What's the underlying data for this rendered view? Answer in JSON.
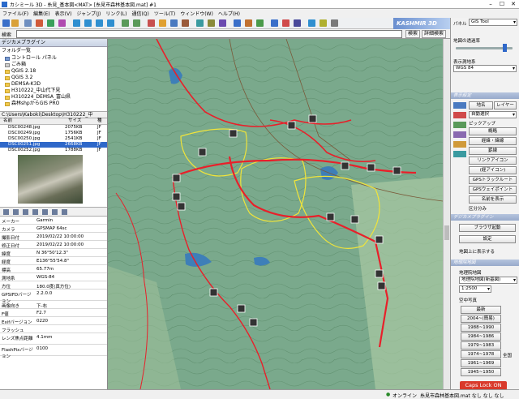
{
  "window": {
    "title": "カシミール 3D - 糸見_基本図<MAT> [糸見市森林基本図.mat] #1",
    "minimize": "–",
    "maximize": "☐",
    "close": "✕"
  },
  "menu": [
    "ファイル(F)",
    "編集(E)",
    "表示(V)",
    "ジャンプ(J)",
    "リンク(L)",
    "通信(Q)",
    "ツール(T)",
    "ウィンドウ(W)",
    "ヘルプ(H)"
  ],
  "branding": "KASHMIR 3D",
  "search": {
    "label": "検索",
    "value": "",
    "button_search": "検索",
    "button_detail": "詳細検索"
  },
  "left": {
    "plugin_header": "デジカメプラグイン",
    "folder_header": "フォルダ一覧",
    "folders": [
      "コントロール パネル",
      "ごみ箱",
      "QGIS 2.18",
      "QGIS 3.2",
      "DEMSA-K3D",
      "H310222_中山代下見",
      "H310224_DEMSA_富山県",
      "森林shpからGIS PRO"
    ],
    "path": "C:\\Users\\Kaboki\\Desktop\\H310222_中",
    "file_columns": [
      "名前",
      "サイズ",
      "種"
    ],
    "files": [
      {
        "name": "DSC00248.jpg",
        "size": "2075KB",
        "type": "JF"
      },
      {
        "name": "DSC00249.jpg",
        "size": "1756KB",
        "type": "JF"
      },
      {
        "name": "DSC00250.jpg",
        "size": "2541KB",
        "type": "JF"
      },
      {
        "name": "DSC00251.jpg",
        "size": "2668KB",
        "type": "JF"
      },
      {
        "name": "DSC00252.jpg",
        "size": "1788KB",
        "type": "JF"
      }
    ],
    "selected_file": 3,
    "properties": [
      {
        "k": "メーカー",
        "v": "Garmin"
      },
      {
        "k": "カメラ",
        "v": "GPSMAP 64sc"
      },
      {
        "k": "撮影日付",
        "v": "2019/02/22 10:00:00"
      },
      {
        "k": "修正日付",
        "v": "2019/02/22 10:00:00"
      },
      {
        "k": "緯度",
        "v": "N 36°50'12.3\""
      },
      {
        "k": "経度",
        "v": "E136°55'54.8\""
      },
      {
        "k": "標高",
        "v": "65.77m"
      },
      {
        "k": "測地系",
        "v": "WGS-84"
      },
      {
        "k": "方位",
        "v": "180.0度(真方位)"
      },
      {
        "k": "GPSIFDバージョン",
        "v": "2.2.0.0"
      },
      {
        "k": "画像向き",
        "v": "下-右"
      },
      {
        "k": "F値",
        "v": "F2.7"
      },
      {
        "k": "Exifバージョン",
        "v": "0220"
      },
      {
        "k": "フラッシュ",
        "v": ""
      },
      {
        "k": "レンズ焦点距離",
        "v": "4.1mm"
      },
      {
        "k": "FlashPixバージョン",
        "v": "0100"
      }
    ]
  },
  "right": {
    "panel_label": "パネル",
    "panel_select": "GIS Tool",
    "transparency_label": "地図の透過率",
    "datum_label": "表示測地系",
    "datum_select": "WGS 84",
    "section_display": "表示設定",
    "btn_placename": "地名",
    "btn_layer": "レイヤー",
    "sel_auto": "自動選択",
    "chk_pickup": "ピックアップ",
    "btn_overview": "概略",
    "btn_latlon": "経緯・緯線",
    "btn_grid": "罫線",
    "btn_link_icon": "リンクアイコン",
    "btn_route_icon": "(経アイコン)",
    "btn_gps_track": "GPSトラックルート",
    "btn_gps_waypoint": "GPSウェイポイント",
    "btn_name_display": "名前を表示",
    "chk_filter": "区分分み",
    "section_plugin": "デジカメプラグイン",
    "btn_browser": "ブラウザ起動",
    "btn_setting": "設定",
    "chk_show_on_map": "地図上に表示する",
    "section_map": "地理院地図",
    "map_label": "地理院地図",
    "map_select": "地理院地図(新基図)",
    "scale_value": "1:2500",
    "aerial_label": "空中写真",
    "aerial_latest": "最新",
    "aerial_years": [
      "2004~(簡易)",
      "1988~1990",
      "1984~1986",
      "1979~1983",
      "1974~1978",
      "1961~1969",
      "1945~1950"
    ],
    "aerial_all": "全国",
    "status_suffix": "なし なし なし"
  },
  "capslock": "Caps Lock ON",
  "status": {
    "online": "オンライン",
    "filename": "糸見市森林基本図.mat なし なし なし"
  },
  "colors": {
    "accent": "#2f68c9",
    "track_red": "#e8202a",
    "track_yellow": "#f0e43a",
    "map_green": "#7aa98c",
    "water": "#3e7fb8"
  }
}
